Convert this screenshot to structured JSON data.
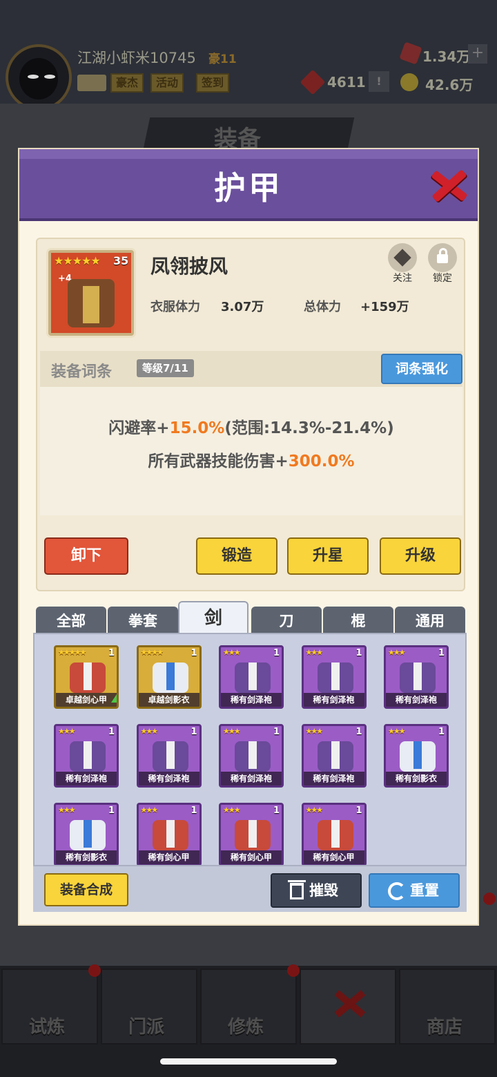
{
  "player": {
    "name": "江湖小虾米10745",
    "rank": "豪11",
    "buttons": [
      "豪杰",
      "活动",
      "签到"
    ]
  },
  "resources": {
    "gems": "1.34万",
    "tokens": "4611",
    "gold": "42.6万"
  },
  "background_title": "装备",
  "modal": {
    "title": "护甲"
  },
  "item": {
    "name": "凤翎披风",
    "stars": "★★★★★",
    "star_level": "35",
    "plus": "+4",
    "stats": {
      "clothing_hp_label": "衣服体力",
      "clothing_hp_value": "3.07万",
      "total_hp_label": "总体力",
      "total_hp_value": "+159万"
    },
    "follow_label": "关注",
    "lock_label": "锁定"
  },
  "affix": {
    "label": "装备词条",
    "level": "等级7/11",
    "enhance_label": "词条强化",
    "line1_prefix": "闪避率+",
    "line1_value": "15.0%",
    "line1_range": "(范围:14.3%-21.4%)",
    "line2_prefix": "所有武器技能伤害+",
    "line2_value": "300.0%"
  },
  "actions": {
    "unequip": "卸下",
    "forge": "锻造",
    "star_up": "升星",
    "level_up": "升级"
  },
  "tabs": [
    "全部",
    "拳套",
    "剑",
    "刀",
    "棍",
    "通用"
  ],
  "active_tab": "剑",
  "inventory": [
    {
      "name": "卓越剑心甲",
      "stars": "★★★★★",
      "count": "1",
      "rarity": "gold",
      "armor": "red",
      "upgrade": true
    },
    {
      "name": "卓越剑影衣",
      "stars": "★★★★",
      "count": "1",
      "rarity": "gold",
      "armor": "white"
    },
    {
      "name": "稀有剑泽袍",
      "stars": "★★★",
      "count": "1",
      "rarity": "purple",
      "armor": "purple"
    },
    {
      "name": "稀有剑泽袍",
      "stars": "★★★",
      "count": "1",
      "rarity": "purple",
      "armor": "purple"
    },
    {
      "name": "稀有剑泽袍",
      "stars": "★★★",
      "count": "1",
      "rarity": "purple",
      "armor": "purple"
    },
    {
      "name": "稀有剑泽袍",
      "stars": "★★★",
      "count": "1",
      "rarity": "purple",
      "armor": "purple"
    },
    {
      "name": "稀有剑泽袍",
      "stars": "★★★",
      "count": "1",
      "rarity": "purple",
      "armor": "purple"
    },
    {
      "name": "稀有剑泽袍",
      "stars": "★★★",
      "count": "1",
      "rarity": "purple",
      "armor": "purple"
    },
    {
      "name": "稀有剑泽袍",
      "stars": "★★★",
      "count": "1",
      "rarity": "purple",
      "armor": "purple"
    },
    {
      "name": "稀有剑影衣",
      "stars": "★★★",
      "count": "1",
      "rarity": "purple",
      "armor": "white"
    },
    {
      "name": "稀有剑影衣",
      "stars": "★★★",
      "count": "1",
      "rarity": "purple",
      "armor": "white"
    },
    {
      "name": "稀有剑心甲",
      "stars": "★★★",
      "count": "1",
      "rarity": "purple",
      "armor": "red"
    },
    {
      "name": "稀有剑心甲",
      "stars": "★★★",
      "count": "1",
      "rarity": "purple",
      "armor": "red"
    },
    {
      "name": "稀有剑心甲",
      "stars": "★★★",
      "count": "1",
      "rarity": "purple",
      "armor": "red"
    }
  ],
  "inventory_actions": {
    "synthesize": "装备合成",
    "destroy": "摧毁",
    "reset": "重置"
  },
  "bottom_nav": [
    "试炼",
    "门派",
    "修炼",
    "",
    "商店"
  ],
  "colors": {
    "accent_orange": "#f07a20",
    "header_purple": "#6a4f9c",
    "button_yellow": "#f9d43a",
    "button_blue": "#4a98dc",
    "button_red": "#e2563a"
  }
}
